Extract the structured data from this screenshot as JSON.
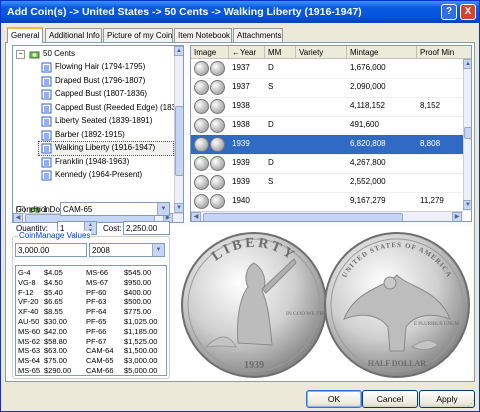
{
  "window": {
    "title": "Add Coin(s) -> United States -> 50 Cents -> Walking Liberty (1916-1947)",
    "help_glyph": "?",
    "close_glyph": "X"
  },
  "tabs": [
    "General",
    "Additional Info",
    "Picture of my Coin",
    "Item Notebook",
    "Attachments"
  ],
  "tree": {
    "root": {
      "label": "50 Cents",
      "expander": "−"
    },
    "items": [
      {
        "label": "Flowing Hair (1794-1795)"
      },
      {
        "label": "Draped Bust (1796-1807)"
      },
      {
        "label": "Capped Bust (1807-1836)"
      },
      {
        "label": "Capped Bust (Reeded Edge) (183"
      },
      {
        "label": "Liberty Seated (1839-1891)"
      },
      {
        "label": "Barber (1892-1915)"
      },
      {
        "label": "Walking Liberty (1916-1947)"
      },
      {
        "label": "Franklin (1948-1963)"
      },
      {
        "label": "Kennedy (1964-Present)"
      }
    ],
    "next_root": {
      "label": "1 Dollar",
      "expander": "+"
    },
    "selected_index": 6
  },
  "form": {
    "condition_label": "Condition:",
    "condition_value": "CAM-65",
    "quantity_label": "Quantity:",
    "quantity_value": "1",
    "cost_label": "Cost:",
    "cost_value": "2,250.00"
  },
  "values": {
    "group_label": "CoinManage Values",
    "current_value": "3,000.00",
    "year": "2008",
    "rows": [
      [
        "G-4",
        "$4.05",
        "MS-66",
        "$545.00"
      ],
      [
        "VG-8",
        "$4.50",
        "MS-67",
        "$950.00"
      ],
      [
        "F-12",
        "$5.40",
        "PF-60",
        "$400.00"
      ],
      [
        "VF-20",
        "$6.65",
        "PF-63",
        "$500.00"
      ],
      [
        "XF-40",
        "$8.55",
        "PF-64",
        "$775.00"
      ],
      [
        "AU-50",
        "$30.00",
        "PF-65",
        "$1,025.00"
      ],
      [
        "MS-60",
        "$42.00",
        "PF-66",
        "$1,185.00"
      ],
      [
        "MS-62",
        "$58.80",
        "PF-67",
        "$1,525.00"
      ],
      [
        "MS-63",
        "$63.00",
        "CAM-64",
        "$1,500.00"
      ],
      [
        "MS-64",
        "$75.00",
        "CAM-65",
        "$3,000.00"
      ],
      [
        "MS-65",
        "$290.00",
        "CAM-66",
        "$5,000.00"
      ]
    ]
  },
  "grid": {
    "columns": [
      "Image",
      "Year",
      "MM",
      "Variety",
      "Mintage",
      "Proof Min"
    ],
    "sort_glyph": "←",
    "rows": [
      {
        "year": "1937",
        "mm": "D",
        "variety": "",
        "mintage": "1,676,000",
        "proof": ""
      },
      {
        "year": "1937",
        "mm": "S",
        "variety": "",
        "mintage": "2,090,000",
        "proof": ""
      },
      {
        "year": "1938",
        "mm": "",
        "variety": "",
        "mintage": "4,118,152",
        "proof": "8,152"
      },
      {
        "year": "1938",
        "mm": "D",
        "variety": "",
        "mintage": "491,600",
        "proof": ""
      },
      {
        "year": "1939",
        "mm": "",
        "variety": "",
        "mintage": "6,820,808",
        "proof": "8,808"
      },
      {
        "year": "1939",
        "mm": "D",
        "variety": "",
        "mintage": "4,267,800",
        "proof": ""
      },
      {
        "year": "1939",
        "mm": "S",
        "variety": "",
        "mintage": "2,552,000",
        "proof": ""
      },
      {
        "year": "1940",
        "mm": "",
        "variety": "",
        "mintage": "9,167,279",
        "proof": "11,279"
      }
    ],
    "selected_index": 4
  },
  "coin_images": {
    "obverse_inscriptions": [
      "LIBERTY",
      "IN GOD WE TRUST",
      "1939"
    ],
    "reverse_inscriptions": [
      "UNITED STATES OF AMERICA",
      "E PLURIBUS UNUM",
      "HALF DOLLAR"
    ]
  },
  "buttons": {
    "ok": "OK",
    "cancel": "Cancel",
    "apply": "Apply"
  }
}
